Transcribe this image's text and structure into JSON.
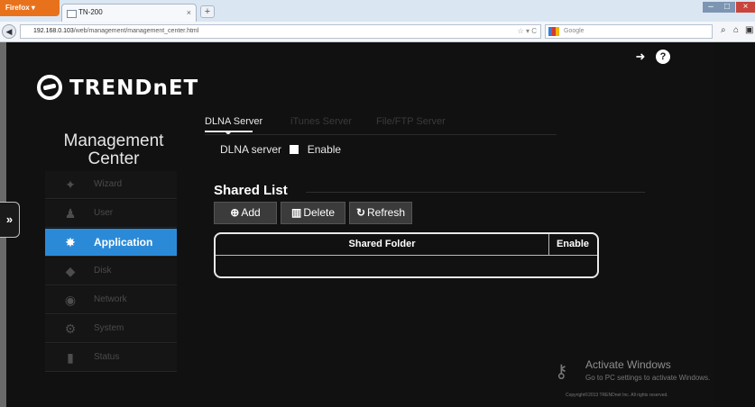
{
  "browser": {
    "menu_button": "Firefox ▾",
    "tab_title": "TN-200",
    "tab_close": "×",
    "new_tab": "+",
    "url_host": "192.168.0.103",
    "url_path": "/web/management/management_center.html",
    "url_icons": "☆ ▾ C",
    "search_placeholder": "Google",
    "window_min": "–",
    "window_max": "□",
    "window_close": "×",
    "back": "◀",
    "nav_icons": {
      "search": "⌕",
      "home": "⌂",
      "menu": "▣"
    }
  },
  "app": {
    "logo_text": "TRENDnET",
    "title_line1": "Management",
    "title_line2": "Center",
    "expand_label": "»",
    "sidebar": [
      {
        "label": "Wizard",
        "icon": "wand-icon",
        "glyph": "✦",
        "active": false
      },
      {
        "label": "User",
        "icon": "user-icon",
        "glyph": "♟",
        "active": false
      },
      {
        "label": "Application",
        "icon": "application-icon",
        "glyph": "✸",
        "active": true
      },
      {
        "label": "Disk",
        "icon": "disk-icon",
        "glyph": "◆",
        "active": false
      },
      {
        "label": "Network",
        "icon": "network-icon",
        "glyph": "◉",
        "active": false
      },
      {
        "label": "System",
        "icon": "system-icon",
        "glyph": "⚙",
        "active": false
      },
      {
        "label": "Status",
        "icon": "status-icon",
        "glyph": "▮",
        "active": false
      }
    ],
    "tabs": [
      "DLNA Server",
      "iTunes Server",
      "File/FTP Server"
    ],
    "dlna_label": "DLNA server",
    "enable_label": "Enable",
    "shared_list_title": "Shared List",
    "buttons": {
      "add": "Add",
      "delete": "Delete",
      "refresh": "Refresh"
    },
    "table_headers": {
      "folder": "Shared Folder",
      "enable": "Enable"
    }
  },
  "watermark": {
    "title": "Activate Windows",
    "subtitle": "Go to PC settings to activate Windows.",
    "copyright": "Copyright©2013 TRENDnet Inc. All rights reserved."
  }
}
